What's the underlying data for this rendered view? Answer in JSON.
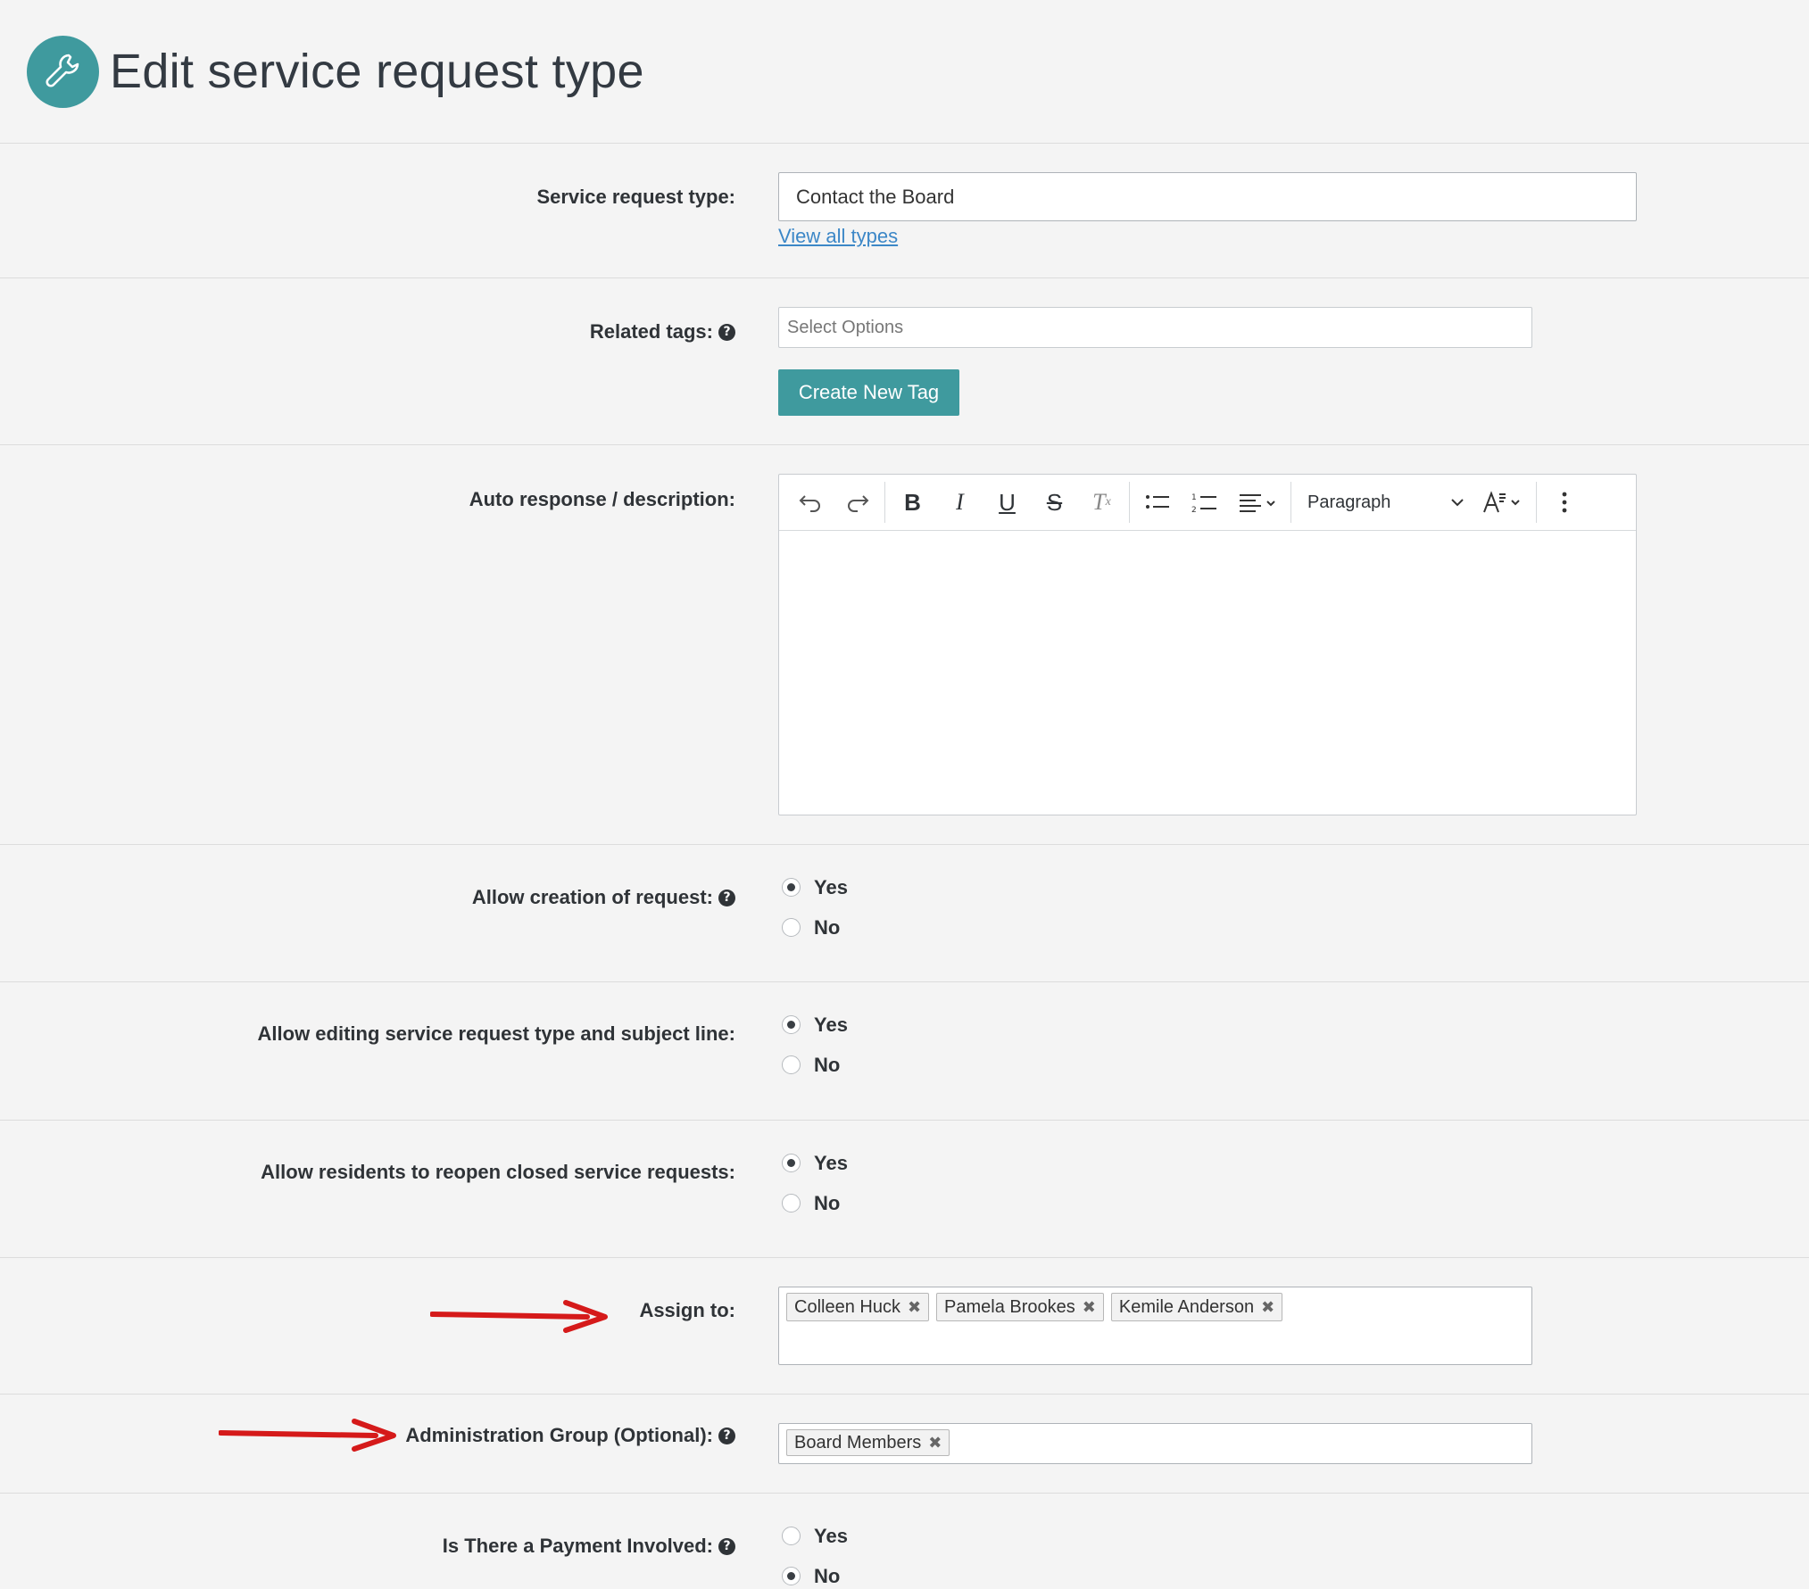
{
  "header": {
    "title": "Edit service request type",
    "icon": "wrench-icon",
    "accent_color": "#3f9a9e"
  },
  "service_request_type": {
    "label": "Service request type:",
    "value": "Contact the Board",
    "view_all_link": "View all types"
  },
  "related_tags": {
    "label": "Related tags:",
    "placeholder": "Select Options",
    "create_button": "Create New Tag"
  },
  "auto_response": {
    "label": "Auto response / description:",
    "toolbar": {
      "block_format": "Paragraph",
      "icons": [
        "undo-icon",
        "redo-icon",
        "bold-icon",
        "italic-icon",
        "underline-icon",
        "strikethrough-icon",
        "clear-formatting-icon",
        "bullet-list-icon",
        "numbered-list-icon",
        "align-icon",
        "font-size-icon",
        "more-icon"
      ]
    },
    "content": ""
  },
  "allow_creation": {
    "label": "Allow creation of request:",
    "options": [
      "Yes",
      "No"
    ],
    "selected": "Yes"
  },
  "allow_editing": {
    "label": "Allow editing service request type and subject line:",
    "options": [
      "Yes",
      "No"
    ],
    "selected": "Yes"
  },
  "allow_reopen": {
    "label": "Allow residents to reopen closed service requests:",
    "options": [
      "Yes",
      "No"
    ],
    "selected": "Yes"
  },
  "assign_to": {
    "label": "Assign to:",
    "tags": [
      "Colleen Huck",
      "Pamela Brookes",
      "Kemile Anderson"
    ]
  },
  "admin_group": {
    "label": "Administration Group (Optional):",
    "tags": [
      "Board Members"
    ]
  },
  "payment": {
    "label": "Is There a Payment Involved:",
    "options": [
      "Yes",
      "No"
    ],
    "selected": "No"
  }
}
